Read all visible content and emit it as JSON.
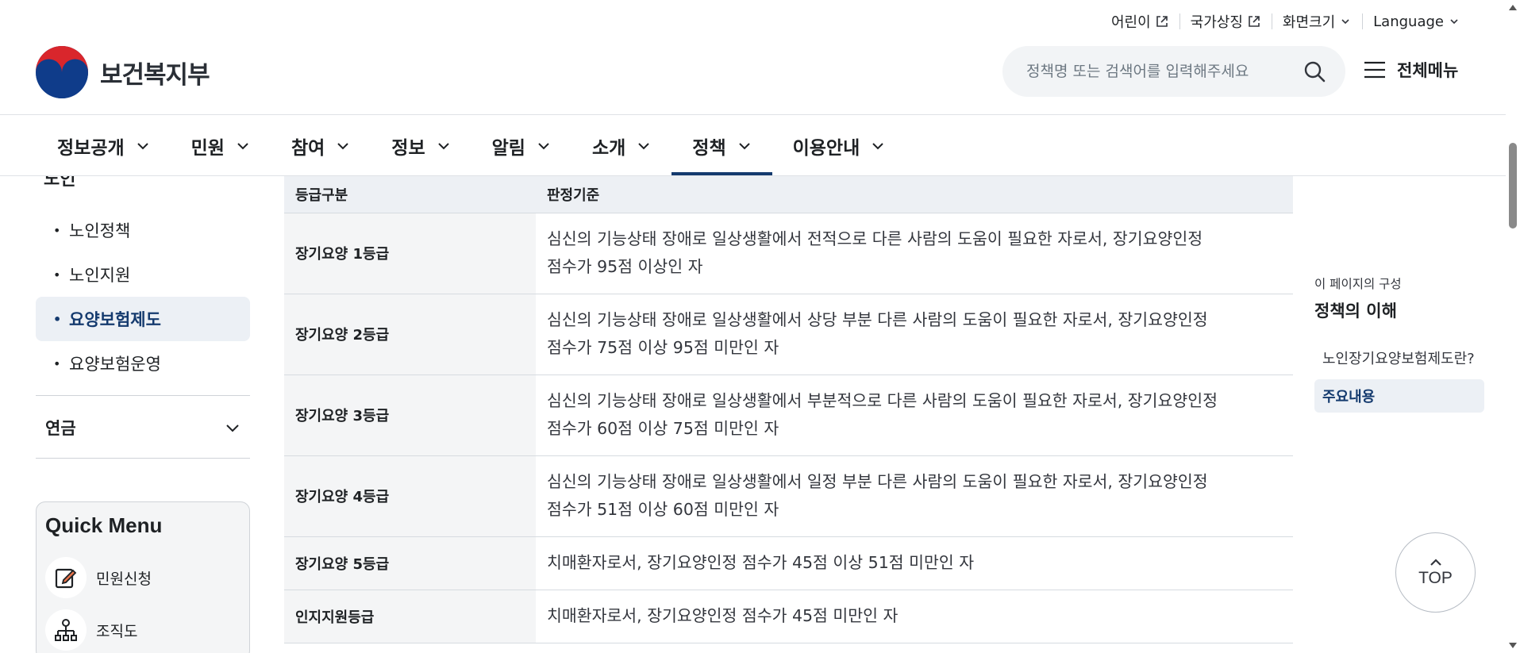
{
  "utility": {
    "items": [
      {
        "label": "어린이",
        "icon": "external-link-icon"
      },
      {
        "label": "국가상징",
        "icon": "external-link-icon"
      },
      {
        "label": "화면크기",
        "icon": "chevron-down-icon"
      },
      {
        "label": "Language",
        "icon": "chevron-down-icon"
      }
    ]
  },
  "logo": {
    "text": "보건복지부"
  },
  "search": {
    "placeholder": "정책명 또는 검색어를 입력해주세요"
  },
  "allmenu": {
    "label": "전체메뉴"
  },
  "gnb": {
    "items": [
      {
        "label": "정보공개"
      },
      {
        "label": "민원"
      },
      {
        "label": "참여"
      },
      {
        "label": "정보"
      },
      {
        "label": "알림"
      },
      {
        "label": "소개"
      },
      {
        "label": "정책",
        "active": true
      },
      {
        "label": "이용안내"
      }
    ]
  },
  "lnb": {
    "top_label": "노인",
    "items": [
      {
        "label": "노인정책"
      },
      {
        "label": "노인지원"
      },
      {
        "label": "요양보험제도",
        "active": true
      },
      {
        "label": "요양보험운영"
      }
    ],
    "section": "연금"
  },
  "quick_menu": {
    "title": "Quick Menu",
    "items": [
      {
        "label": "민원신청",
        "icon": "edit-document-icon"
      },
      {
        "label": "조직도",
        "icon": "org-chart-icon"
      }
    ]
  },
  "table": {
    "headers": [
      "등급구분",
      "판정기준"
    ],
    "rows": [
      {
        "grade": "장기요양 1등급",
        "line1": "심신의 기능상태 장애로 일상생활에서 전적으로 다른 사람의 도움이 필요한 자로서, 장기요양인정",
        "line2": "점수가 95점 이상인 자"
      },
      {
        "grade": "장기요양 2등급",
        "line1": "심신의 기능상태 장애로 일상생활에서 상당 부분 다른 사람의 도움이 필요한 자로서, 장기요양인정",
        "line2": "점수가 75점 이상 95점 미만인 자"
      },
      {
        "grade": "장기요양 3등급",
        "line1": "심신의 기능상태 장애로 일상생활에서 부분적으로 다른 사람의 도움이 필요한 자로서, 장기요양인정",
        "line2": "점수가 60점 이상 75점 미만인 자"
      },
      {
        "grade": "장기요양 4등급",
        "line1": "심신의 기능상태 장애로 일상생활에서 일정 부분 다른 사람의 도움이 필요한 자로서, 장기요양인정",
        "line2": "점수가 51점 이상 60점 미만인 자"
      },
      {
        "grade": "장기요양 5등급",
        "line1": "치매환자로서, 장기요양인정 점수가 45점 이상 51점 미만인 자",
        "line2": ""
      },
      {
        "grade": "인지지원등급",
        "line1": "치매환자로서, 장기요양인정 점수가 45점 미만인 자",
        "line2": ""
      }
    ]
  },
  "toc": {
    "label": "이 페이지의 구성",
    "title": "정책의 이해",
    "items": [
      {
        "label": "노인장기요양보험제도란?"
      },
      {
        "label": "주요내용",
        "active": true
      }
    ]
  },
  "top_button": {
    "label": "TOP"
  },
  "colors": {
    "accent": "#143a6e",
    "header_bg": "#edf0f4",
    "active_bg": "#ecf0f5"
  }
}
